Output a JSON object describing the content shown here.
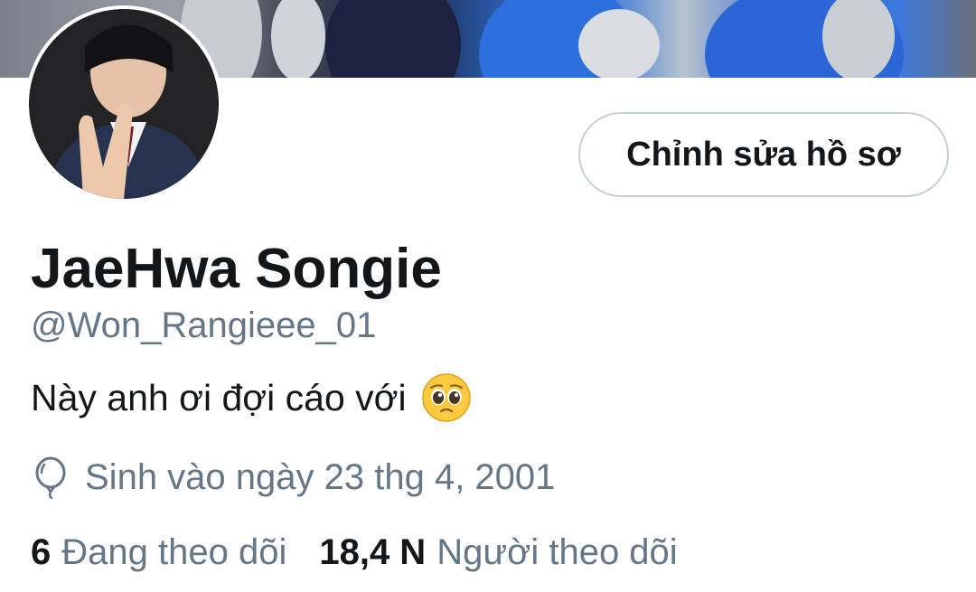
{
  "profile": {
    "display_name": "JaeHwa Songie",
    "handle": "@Won_Rangieee_01",
    "bio": "Này anh ơi đợi cáo với",
    "bio_emoji": "pleading-face-emoji",
    "birthday": "Sinh vào ngày 23 thg 4, 2001",
    "edit_button": "Chỉnh sửa hồ sơ"
  },
  "stats": {
    "following_count": "6",
    "following_label": "Đang theo dõi",
    "followers_count": "18,4 N",
    "followers_label": "Người theo dõi"
  },
  "icons": {
    "birthday": "balloon-icon"
  },
  "colors": {
    "text_primary": "#14171a",
    "text_secondary": "#657786",
    "button_border": "#c4cfd6",
    "background": "#ffffff"
  }
}
